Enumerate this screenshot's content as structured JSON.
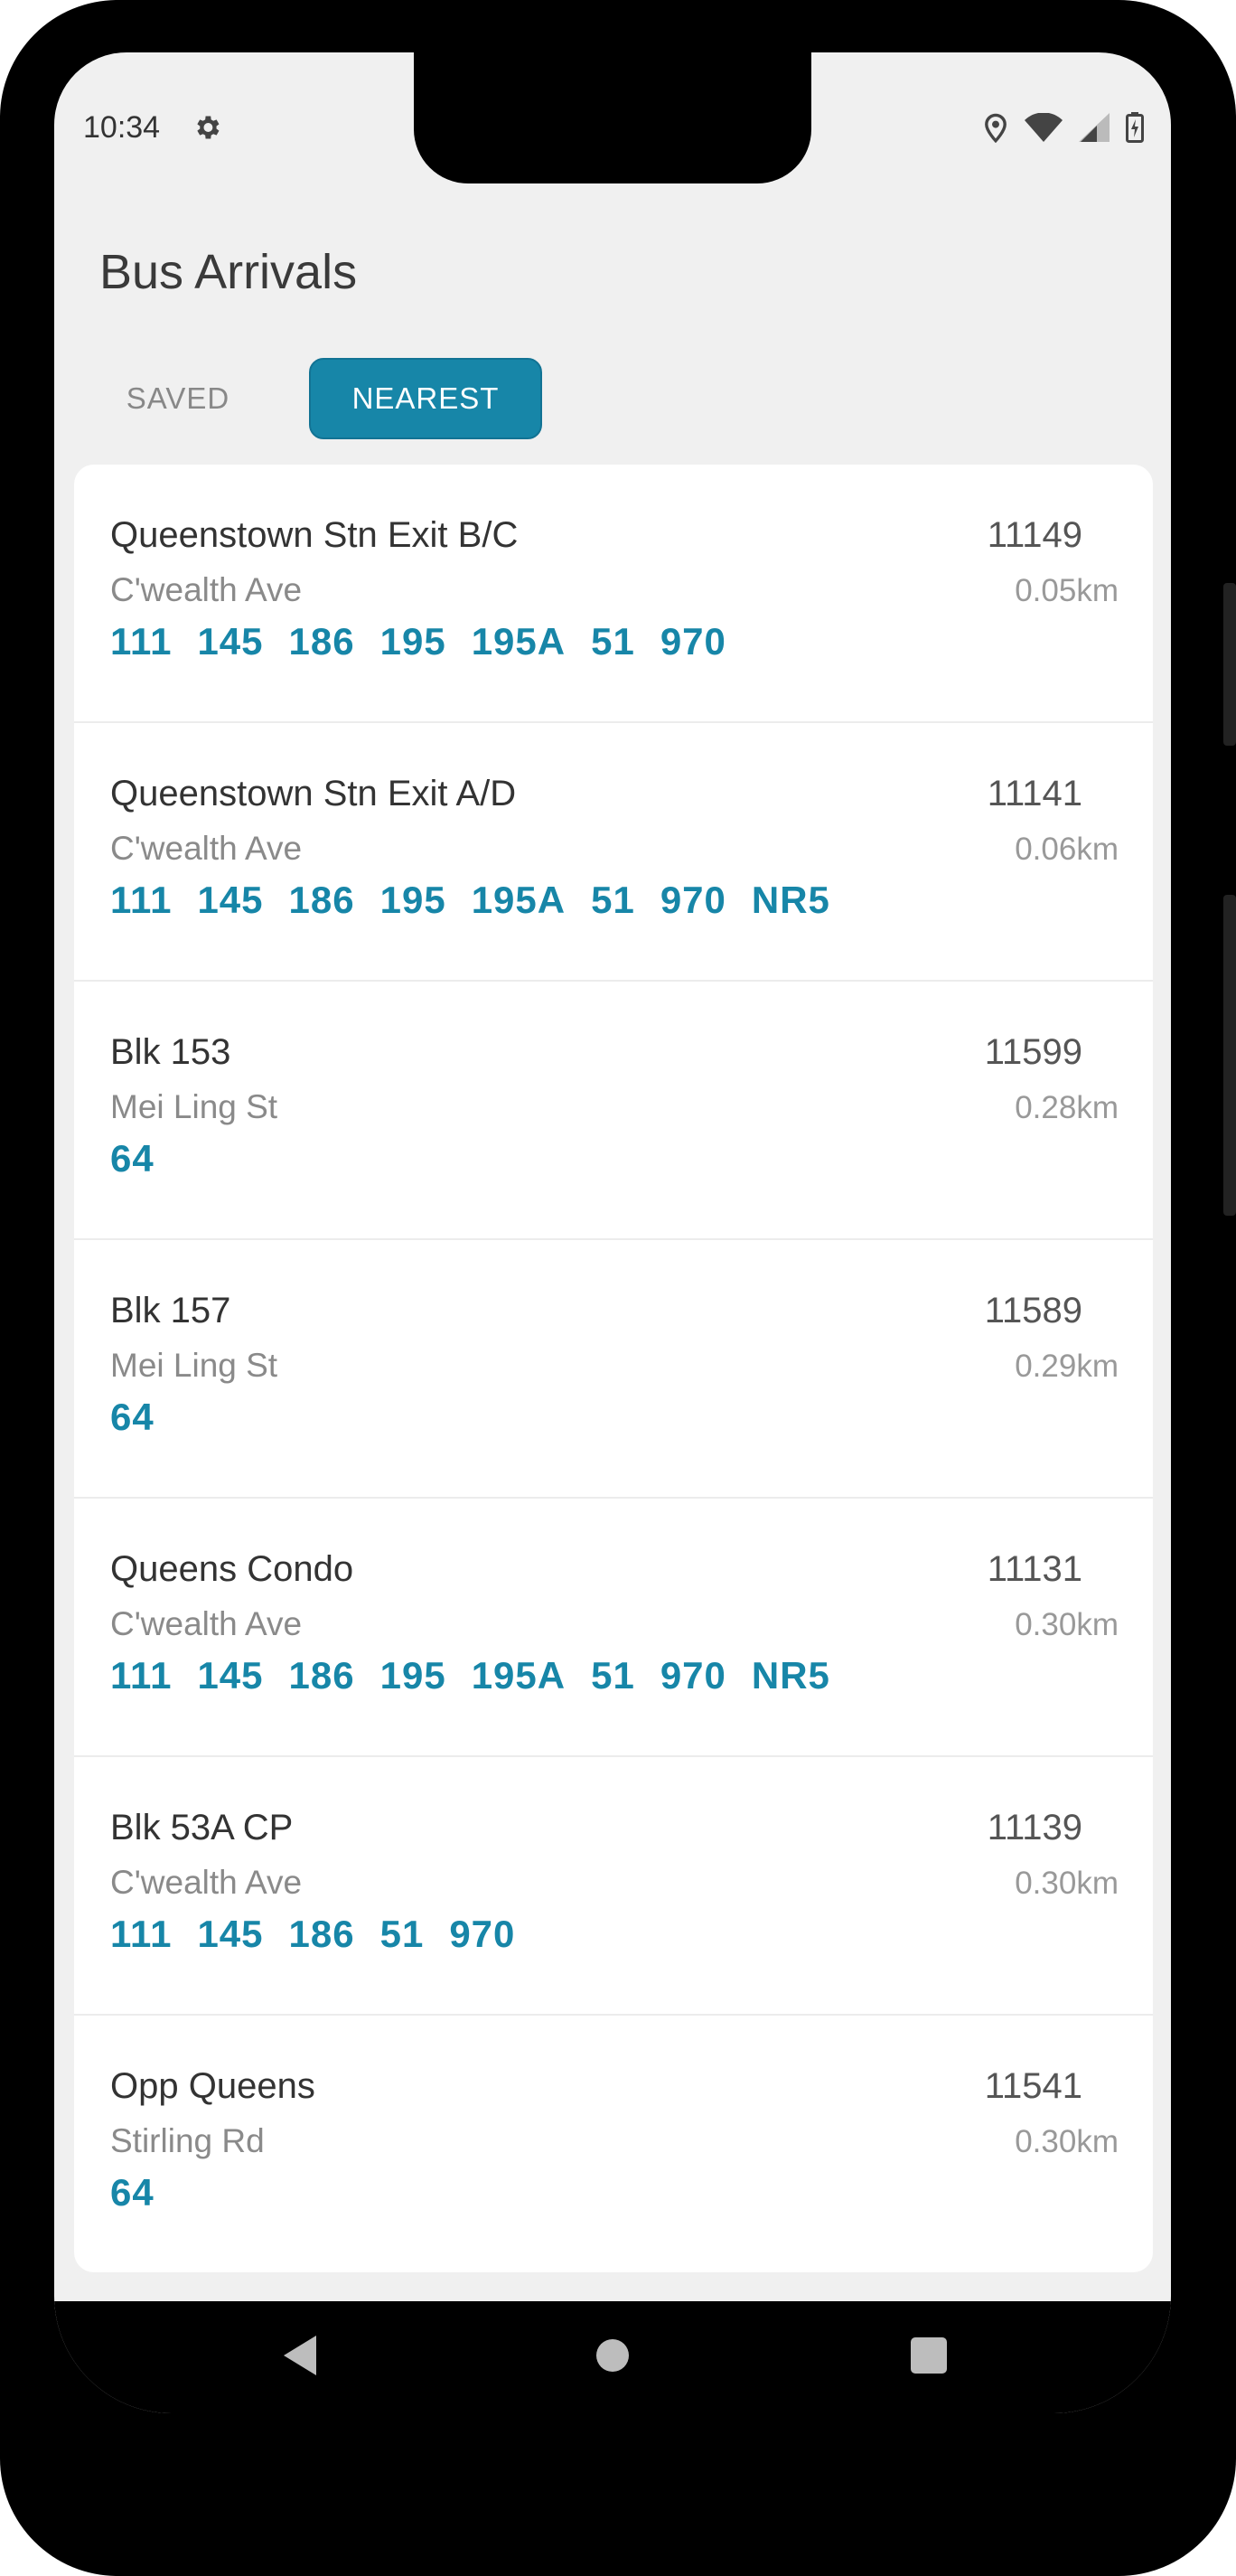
{
  "status_bar": {
    "time": "10:34"
  },
  "header": {
    "title": "Bus Arrivals"
  },
  "tabs": [
    {
      "label": "SAVED",
      "active": false
    },
    {
      "label": "NEAREST",
      "active": true
    }
  ],
  "colors": {
    "accent": "#1786a8",
    "background": "#f0f0f0"
  },
  "stops": [
    {
      "name": "Queenstown Stn Exit B/C",
      "road": "C'wealth Ave",
      "code": "11149",
      "distance": "0.05km",
      "services": [
        "111",
        "145",
        "186",
        "195",
        "195A",
        "51",
        "970"
      ]
    },
    {
      "name": "Queenstown Stn Exit A/D",
      "road": "C'wealth Ave",
      "code": "11141",
      "distance": "0.06km",
      "services": [
        "111",
        "145",
        "186",
        "195",
        "195A",
        "51",
        "970",
        "NR5"
      ]
    },
    {
      "name": "Blk 153",
      "road": "Mei Ling St",
      "code": "11599",
      "distance": "0.28km",
      "services": [
        "64"
      ]
    },
    {
      "name": "Blk 157",
      "road": "Mei Ling St",
      "code": "11589",
      "distance": "0.29km",
      "services": [
        "64"
      ]
    },
    {
      "name": "Queens Condo",
      "road": "C'wealth Ave",
      "code": "11131",
      "distance": "0.30km",
      "services": [
        "111",
        "145",
        "186",
        "195",
        "195A",
        "51",
        "970",
        "NR5"
      ]
    },
    {
      "name": "Blk 53A CP",
      "road": "C'wealth Ave",
      "code": "11139",
      "distance": "0.30km",
      "services": [
        "111",
        "145",
        "186",
        "51",
        "970"
      ]
    },
    {
      "name": "Opp Queens",
      "road": "Stirling Rd",
      "code": "11541",
      "distance": "0.30km",
      "services": [
        "64"
      ]
    }
  ],
  "nav_icons": [
    "back-icon",
    "home-icon",
    "recents-icon"
  ]
}
